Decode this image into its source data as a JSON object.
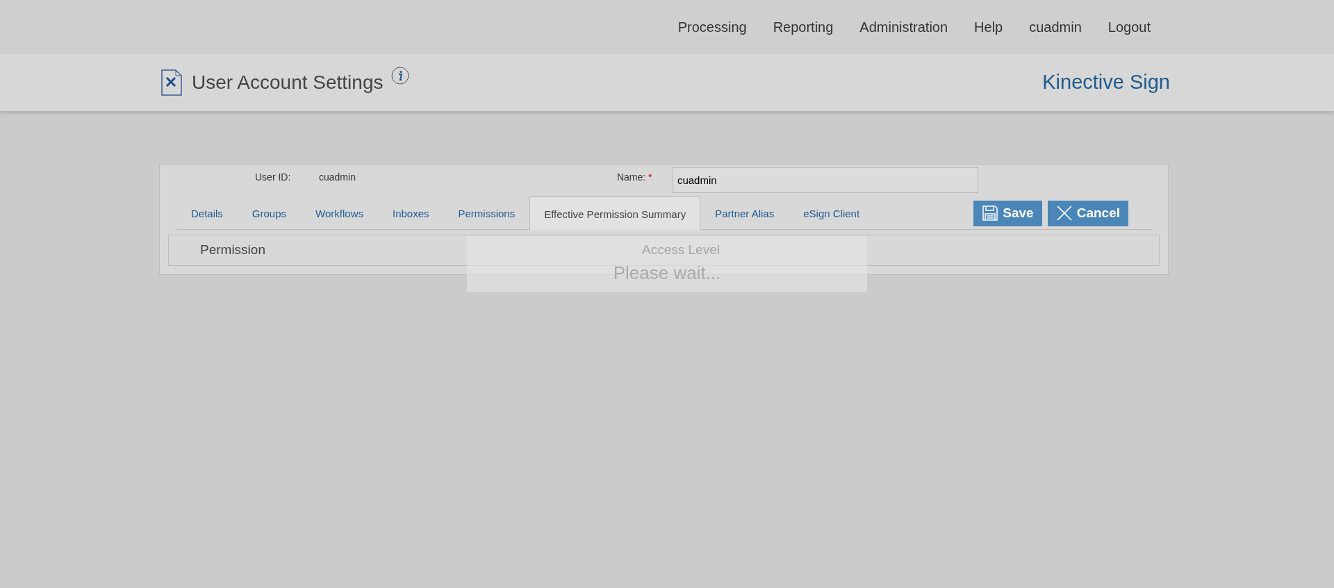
{
  "top_nav": [
    "Processing",
    "Reporting",
    "Administration",
    "Help",
    "cuadmin",
    "Logout"
  ],
  "header": {
    "title": "User Account Settings",
    "brand": "Kinective Sign"
  },
  "user_id": {
    "label": "User ID:",
    "value": "cuadmin"
  },
  "name_field": {
    "label": "Name:",
    "required_mark": "*",
    "value": "cuadmin"
  },
  "tabs": [
    {
      "label": "Details",
      "selected": false
    },
    {
      "label": "Groups",
      "selected": false
    },
    {
      "label": "Workflows",
      "selected": false
    },
    {
      "label": "Inboxes",
      "selected": false
    },
    {
      "label": "Permissions",
      "selected": false
    },
    {
      "label": "Effective Permission Summary",
      "selected": true
    },
    {
      "label": "Partner Alias",
      "selected": false
    },
    {
      "label": "eSign Client",
      "selected": false
    }
  ],
  "buttons": [
    {
      "label": "Save",
      "kind": "save"
    },
    {
      "label": "Cancel",
      "kind": "cancel"
    }
  ],
  "table": {
    "columns": [
      "Permission",
      "Access Level"
    ]
  },
  "loading_overlay": {
    "text": "Please wait..."
  }
}
